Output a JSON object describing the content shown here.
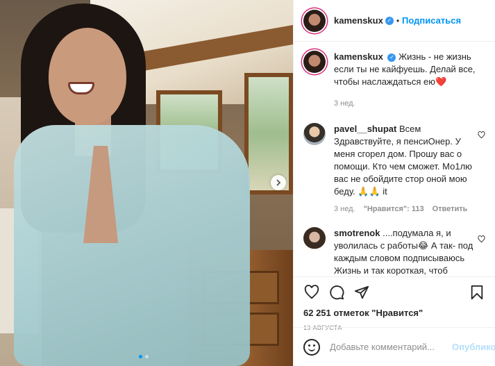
{
  "post": {
    "username": "kamenskux",
    "follow_label": "Подписаться",
    "separator": "•",
    "caption": "Жизнь - не жизнь если ты не кайфуешь. Делай все, чтобы наслаждаться ею",
    "caption_emoji": "❤️",
    "caption_time": "3 нед."
  },
  "comments": [
    {
      "username": "pavel__shupat",
      "text": "Всем Здравствуйте, я пенсиОнер. У меня сгорел дом. Прошу вас о помощи. Кто чем сможет. Мо1лю вас не обойдите стор оной мою беду.",
      "emoji": "🙏🙏",
      "suffix": "it",
      "time": "3 нед.",
      "likes": "\"Нравится\": 113",
      "reply": "Ответить"
    },
    {
      "username": "smotrenok",
      "text": "....подумала я, и уволилась с работы😂 А так- под каждым словом подписываюсь Жизнь и так короткая, чтоб"
    }
  ],
  "actions": {
    "likes_count": "62 251 отметок \"Нравится\"",
    "date": "13 АВГУСТА"
  },
  "add_comment": {
    "placeholder": "Добавьте комментарий...",
    "publish_label": "Опубликовать"
  },
  "carousel": {
    "slides": 2,
    "active": 0
  },
  "colors": {
    "accent": "#0095f6",
    "verified": "#3897f0",
    "ring": "#d82d7e"
  }
}
